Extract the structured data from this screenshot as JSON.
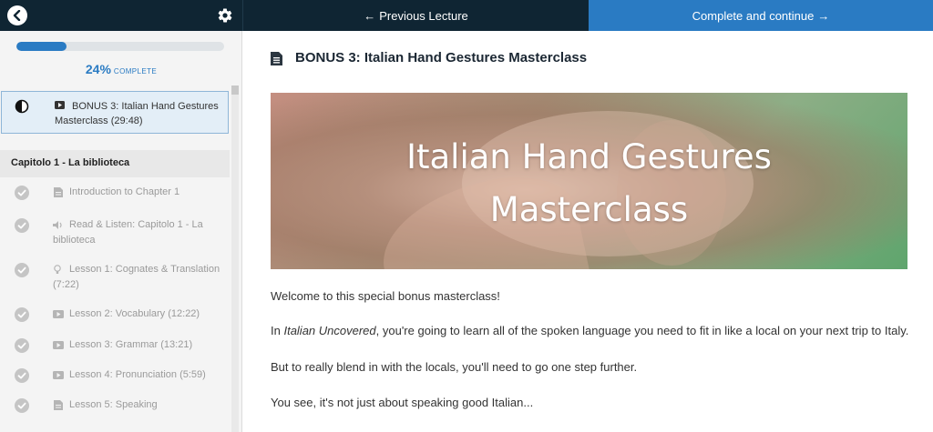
{
  "topbar": {
    "prev_label": "Previous Lecture",
    "next_label": "Complete and continue",
    "accent": "#2a7bc3",
    "dark": "#0f2533"
  },
  "sidebar": {
    "progress_percent": 24,
    "progress_text": "24%",
    "progress_label": "COMPLETE",
    "current_item": {
      "icon": "video-icon",
      "title": "BONUS 3: Italian Hand Gestures Masterclass (29:48)"
    },
    "section_title": "Capitolo 1 - La biblioteca",
    "lectures": [
      {
        "icon": "document-icon",
        "title": "Introduction to Chapter 1"
      },
      {
        "icon": "audio-icon",
        "title": "Read & Listen: Capitolo 1 - La biblioteca"
      },
      {
        "icon": "lightbulb-icon",
        "title": "Lesson 1: Cognates & Translation (7:22)"
      },
      {
        "icon": "video-icon",
        "title": "Lesson 2: Vocabulary (12:22)"
      },
      {
        "icon": "video-icon",
        "title": "Lesson 3: Grammar (13:21)"
      },
      {
        "icon": "video-icon",
        "title": "Lesson 4: Pronunciation (5:59)"
      },
      {
        "icon": "document-icon",
        "title": "Lesson 5: Speaking"
      }
    ]
  },
  "main": {
    "title": "BONUS 3: Italian Hand Gestures Masterclass",
    "banner_line1": "Italian Hand Gestures",
    "banner_line2": "Masterclass",
    "p1": "Welcome to this special bonus masterclass!",
    "p2_prefix": "In ",
    "p2_italic": "Italian Uncovered",
    "p2_suffix": ", you're going to learn all of the spoken language you need to fit in like a local on your next trip to Italy.",
    "p3": "But to really blend in with the locals, you'll need to go one step further.",
    "p4": "You see, it's not just about speaking good Italian..."
  }
}
